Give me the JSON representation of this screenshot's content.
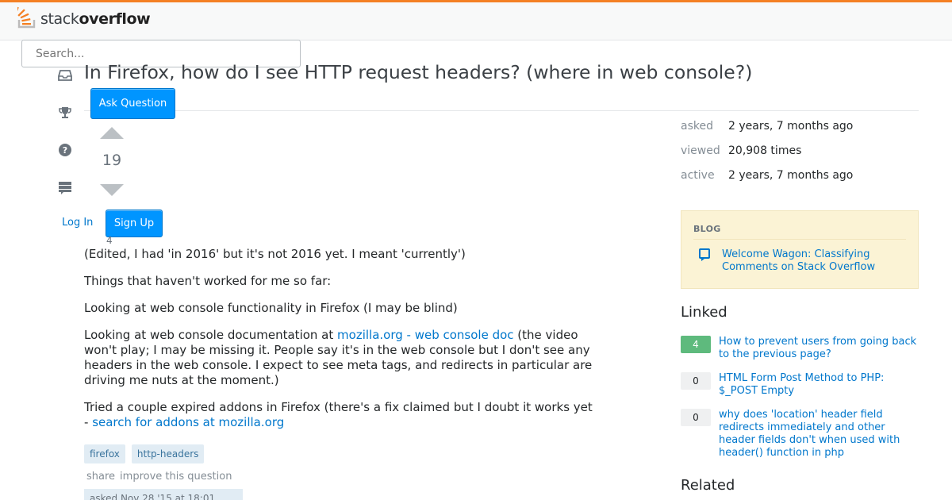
{
  "header": {
    "logo_text_light": "stack",
    "logo_text_bold": "overflow",
    "search_placeholder": "Search..."
  },
  "sidebar": {
    "icons": [
      "inbox-icon",
      "trophy-icon",
      "help-icon",
      "review-icon"
    ],
    "login_label": "Log In",
    "signup_label": "Sign Up",
    "ask_label": "Ask Question"
  },
  "question": {
    "title": "In Firefox, how do I see HTTP request headers? (where in web console?)",
    "votes": "19",
    "favorites": "4",
    "body": {
      "p1": "(Edited, I had 'in 2016' but it's not 2016 yet. I meant 'currently')",
      "p2": "Things that haven't worked for me so far:",
      "p3": "Looking at web console functionality in Firefox (I may be blind)",
      "p4_before": "Looking at web console documentation at ",
      "p4_link": "mozilla.org - web console doc",
      "p4_after": " (the video won't play; I may be missing it. People say it's in the web console but I don't see any headers in the web console. I expect to see meta tags, and redirects in particular are driving me nuts at the moment.)",
      "p5_before": "Tried a couple expired addons in Firefox (there's a fix claimed but I doubt it works yet - ",
      "p5_link": "search for addons at mozilla.org",
      "p5_after": ""
    },
    "tags": [
      "firefox",
      "http-headers"
    ],
    "menu": {
      "share": "share",
      "improve": "improve this question"
    },
    "asked_text": "asked Nov 28 '15 at 18:01"
  },
  "stats": {
    "asked_label": "asked",
    "asked_value": "2 years, 7 months ago",
    "viewed_label": "viewed",
    "viewed_value": "20,908 times",
    "active_label": "active",
    "active_value": "2 years, 7 months ago"
  },
  "blog": {
    "heading": "BLOG",
    "post": "Welcome Wagon: Classifying Comments on Stack Overflow"
  },
  "linked": {
    "title": "Linked",
    "items": [
      {
        "score": "4",
        "title": "How to prevent users from going back to the previous page?"
      },
      {
        "score": "0",
        "title": "HTML Form Post Method to PHP: $_POST Empty"
      },
      {
        "score": "0",
        "title": "why does 'location' header field redirects immediately and other header fields don't when used with header() function in php"
      }
    ]
  },
  "related": {
    "title": "Related"
  },
  "colors": {
    "brand_orange": "#f48024",
    "link_blue": "#0077cc",
    "button_blue": "#0095ff",
    "accepted_green": "#5eba7d"
  }
}
